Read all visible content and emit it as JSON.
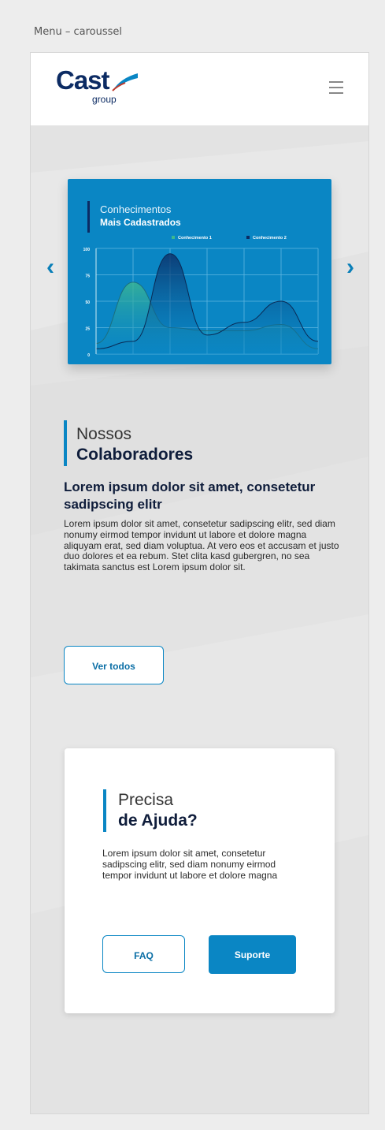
{
  "frame_label": "Menu – caroussel",
  "header": {
    "logo_text": "Cast",
    "logo_sub": "group",
    "menu_icon": "hamburger-menu-icon"
  },
  "carousel": {
    "prev_icon": "chevron-left-icon",
    "next_icon": "chevron-right-icon",
    "prev_glyph": "‹",
    "next_glyph": "›",
    "card_color": "#0a86c4",
    "chart_data": {
      "type": "area",
      "title_line1": "Conhecimentos",
      "title_line2": "Mais Cadastrados",
      "legend": [
        "Conhecimento 1",
        "Conhecimento 2"
      ],
      "y_ticks": [
        "100",
        "75",
        "50",
        "25",
        "0"
      ],
      "ylim": [
        0,
        100
      ],
      "grid": true,
      "legend_position": "top-right",
      "x": [
        0,
        1,
        2,
        3,
        4,
        5,
        6
      ],
      "series": [
        {
          "name": "Conhecimento 1",
          "color": "#3db88f",
          "values": [
            10,
            68,
            25,
            22,
            22,
            28,
            5
          ]
        },
        {
          "name": "Conhecimento 2",
          "color": "#0c2b63",
          "values": [
            5,
            12,
            95,
            18,
            30,
            50,
            12
          ]
        }
      ]
    }
  },
  "colaboradores": {
    "title_line1": "Nossos",
    "title_line2": "Colaboradores",
    "heading": "Lorem ipsum dolor sit amet, consetetur sadipscing elitr",
    "body": "Lorem ipsum dolor sit amet, consetetur sadipscing elitr, sed diam nonumy eirmod tempor invidunt ut labore et dolore magna aliquyam erat, sed diam voluptua. At vero eos et accusam et justo duo dolores et ea rebum. Stet clita kasd gubergren, no sea takimata sanctus est Lorem ipsum dolor sit.",
    "button_label": "Ver todos"
  },
  "help": {
    "title_line1": "Precisa",
    "title_line2": "de Ajuda?",
    "body": "Lorem ipsum dolor sit amet, consetetur sadipscing elitr, sed diam nonumy eirmod tempor invidunt ut labore et dolore magna",
    "faq_label": "FAQ",
    "support_label": "Suporte"
  },
  "colors": {
    "accent": "#0a86c4",
    "navy": "#0c2b63",
    "green": "#3db88f"
  }
}
